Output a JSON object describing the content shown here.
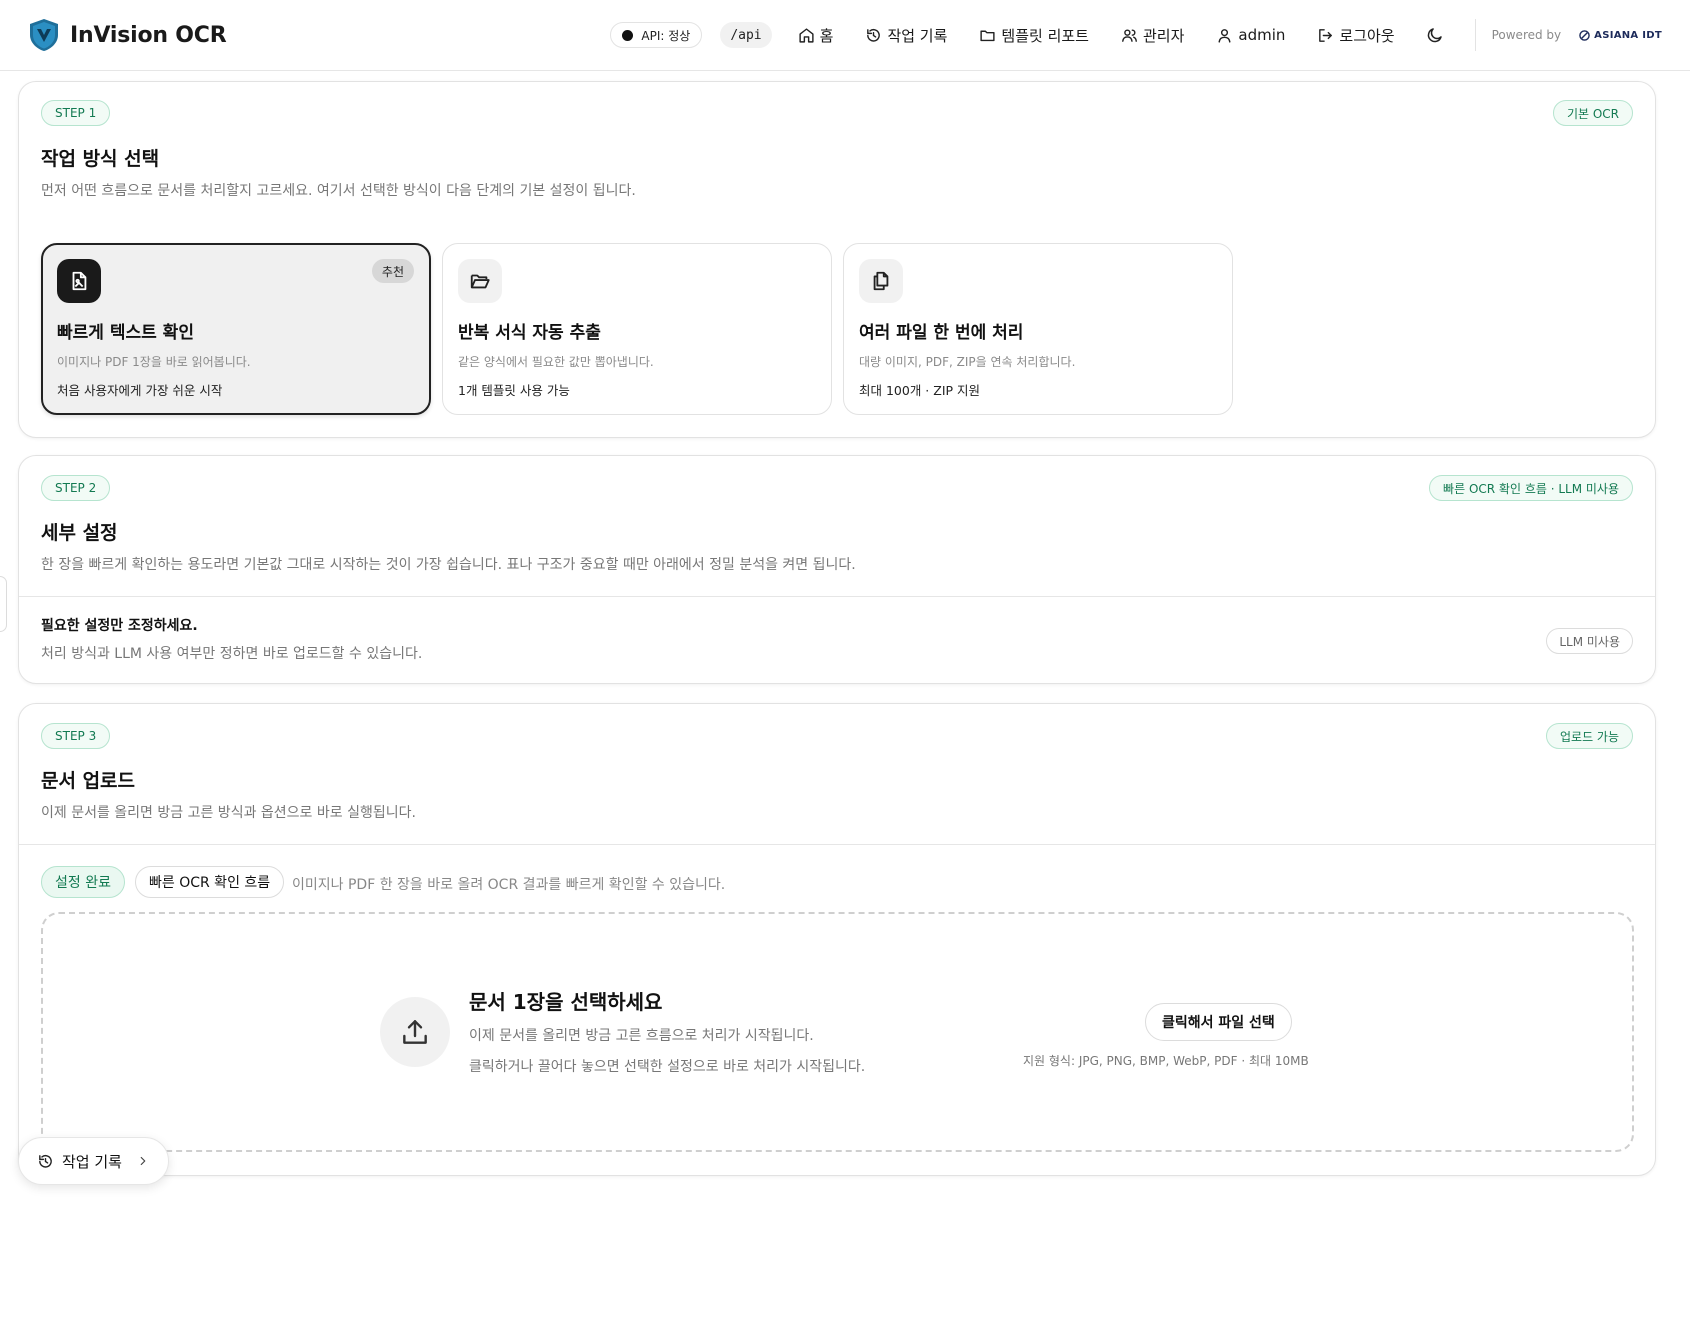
{
  "app": {
    "title": "InVision OCR"
  },
  "header": {
    "api_status": "API: 정상",
    "api_path": "/api",
    "nav": [
      {
        "label": "홈",
        "icon": "home-icon"
      },
      {
        "label": "작업 기록",
        "icon": "history-icon"
      },
      {
        "label": "템플릿 리포트",
        "icon": "folder-icon"
      },
      {
        "label": "관리자",
        "icon": "users-icon"
      },
      {
        "label": "admin",
        "icon": "user-icon"
      },
      {
        "label": "로그아웃",
        "icon": "logout-icon"
      }
    ],
    "theme_icon": "moon-icon",
    "powered_by": "Powered by",
    "partner": "ASIANA IDT"
  },
  "step1": {
    "badge": "STEP 1",
    "tag": "기본 OCR",
    "title": "작업 방식 선택",
    "description": "먼저 어떤 흐름으로 문서를 처리할지 고르세요. 여기서 선택한 방식이 다음 단계의 기본 설정이 됩니다.",
    "options": [
      {
        "title": "빠르게 텍스트 확인",
        "desc": "이미지나 PDF 1장을 바로 읽어봅니다.",
        "note": "처음 사용자에게 가장 쉬운 시작",
        "badge": "추천",
        "icon": "image-file-icon",
        "selected": true
      },
      {
        "title": "반복 서식 자동 추출",
        "desc": "같은 양식에서 필요한 값만 뽑아냅니다.",
        "note": "1개 템플릿 사용 가능",
        "icon": "folder-open-icon",
        "selected": false
      },
      {
        "title": "여러 파일 한 번에 처리",
        "desc": "대량 이미지, PDF, ZIP을 연속 처리합니다.",
        "note": "최대 100개 · ZIP 지원",
        "icon": "copy-files-icon",
        "selected": false
      }
    ]
  },
  "step2": {
    "badge": "STEP 2",
    "tag": "빠른 OCR 확인 흐름 · LLM 미사용",
    "title": "세부 설정",
    "description": "한 장을 빠르게 확인하는 용도라면 기본값 그대로 시작하는 것이 가장 쉽습니다. 표나 구조가 중요할 때만 아래에서 정밀 분석을 켜면 됩니다.",
    "sub_title": "필요한 설정만 조정하세요.",
    "sub_desc": "처리 방식과 LLM 사용 여부만 정하면 바로 업로드할 수 있습니다.",
    "llm_pill": "LLM 미사용"
  },
  "step3": {
    "badge": "STEP 3",
    "tag": "업로드 가능",
    "title": "문서 업로드",
    "description": "이제 문서를 올리면 방금 고른 방식과 옵션으로 바로 실행됩니다.",
    "chip_done": "설정 완료",
    "chip_flow": "빠른 OCR 확인 흐름",
    "flow_desc": "이미지나 PDF 한 장을 바로 올려 OCR 결과를 빠르게 확인할 수 있습니다.",
    "dropzone": {
      "title": "문서 1장을 선택하세요",
      "line1": "이제 문서를 올리면 방금 고른 흐름으로 처리가 시작됩니다.",
      "line2": "클릭하거나 끌어다 놓으면 선택한 설정으로 바로 처리가 시작됩니다.",
      "button": "클릭해서 파일 선택",
      "formats": "지원 형식: JPG, PNG, BMP, WebP, PDF · 최대 10MB"
    }
  },
  "floating": {
    "history_label": "작업 기록"
  },
  "colors": {
    "accent_green": "#137a52",
    "accent_green_bg": "#f2fbf6",
    "dark": "#1a1a1a"
  }
}
